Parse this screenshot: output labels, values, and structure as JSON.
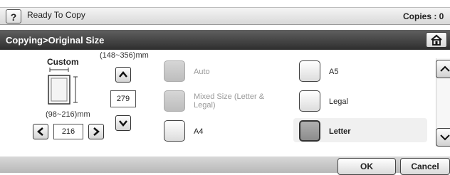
{
  "header": {
    "help_label": "?",
    "status": "Ready To Copy",
    "copies": "Copies : 0"
  },
  "title": "Copying>Original Size",
  "custom": {
    "label": "Custom",
    "length_range": "(148~356)mm",
    "length_value": "279",
    "width_range": "(98~216)mm",
    "width_value": "216"
  },
  "options": [
    {
      "label": "Auto",
      "state": "disabled"
    },
    {
      "label": "Mixed Size (Letter & Legal)",
      "state": "disabled"
    },
    {
      "label": "A4",
      "state": "enabled"
    },
    {
      "label": "A5",
      "state": "enabled"
    },
    {
      "label": "Legal",
      "state": "enabled"
    },
    {
      "label": "Letter",
      "state": "selected"
    }
  ],
  "footer": {
    "ok_label": "OK",
    "cancel_label": "Cancel"
  }
}
